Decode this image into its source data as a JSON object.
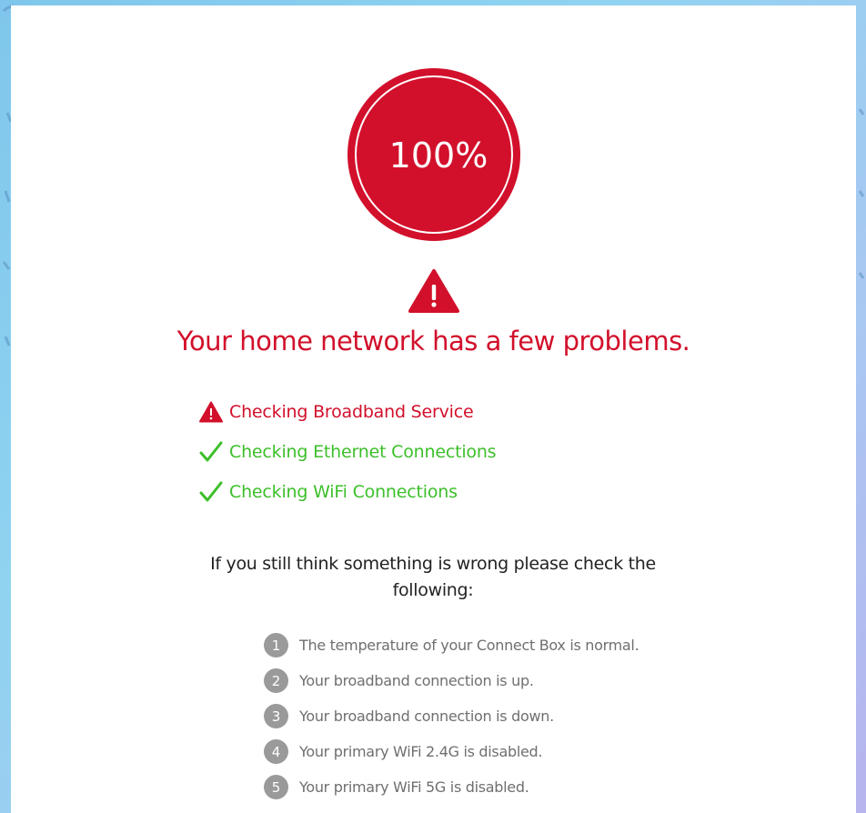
{
  "colors": {
    "brand_red": "#d2102b",
    "success_green": "#3cbf2a",
    "muted_gray": "#9a9a9a"
  },
  "progress": {
    "label": "100%",
    "value": 1.0
  },
  "headline": "Your home network has a few problems.",
  "checks": [
    {
      "label": "Checking Broadband Service",
      "status": "error",
      "icon": "warning-icon"
    },
    {
      "label": "Checking Ethernet Connections",
      "status": "ok",
      "icon": "checkmark-icon"
    },
    {
      "label": "Checking WiFi Connections",
      "status": "ok",
      "icon": "checkmark-icon"
    }
  ],
  "hint": "If you still think something is wrong please check the following:",
  "tips": [
    {
      "number": "1",
      "text": "The temperature of your Connect Box is normal."
    },
    {
      "number": "2",
      "text": "Your broadband connection is up."
    },
    {
      "number": "3",
      "text": "Your broadband connection is down."
    },
    {
      "number": "4",
      "text": "Your primary WiFi 2.4G is disabled."
    },
    {
      "number": "5",
      "text": "Your primary WiFi 5G is disabled."
    }
  ]
}
